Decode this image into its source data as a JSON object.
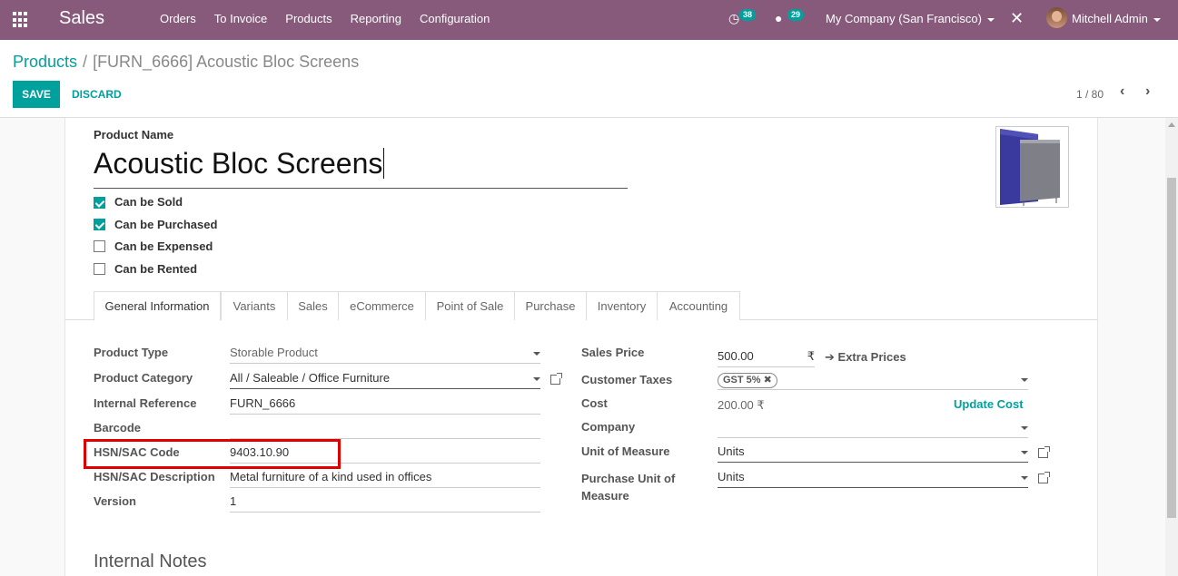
{
  "navbar": {
    "brand": "Sales",
    "menu": [
      "Orders",
      "To Invoice",
      "Products",
      "Reporting",
      "Configuration"
    ],
    "activity_count": "38",
    "message_count": "29",
    "company": "My Company (San Francisco)",
    "user": "Mitchell Admin",
    "icons": [
      "apps-icon",
      "clock-icon",
      "chat-icon",
      "bug-icon"
    ]
  },
  "breadcrumb": {
    "parent": "Products",
    "separator": "/",
    "current": "[FURN_6666] Acoustic Bloc Screens"
  },
  "actions": {
    "save": "SAVE",
    "discard": "DISCARD"
  },
  "pager": {
    "value": "1 / 80"
  },
  "product": {
    "name_label": "Product Name",
    "name": "Acoustic Bloc Screens",
    "flags": [
      {
        "label": "Can be Sold",
        "checked": true
      },
      {
        "label": "Can be Purchased",
        "checked": true
      },
      {
        "label": "Can be Expensed",
        "checked": false
      },
      {
        "label": "Can be Rented",
        "checked": false
      }
    ]
  },
  "tabs": [
    "General Information",
    "Variants",
    "Sales",
    "eCommerce",
    "Point of Sale",
    "Purchase",
    "Inventory",
    "Accounting"
  ],
  "left_fields": {
    "product_type": {
      "label": "Product Type",
      "value": "Storable Product"
    },
    "product_category": {
      "label": "Product Category",
      "value": "All / Saleable / Office Furniture"
    },
    "internal_reference": {
      "label": "Internal Reference",
      "value": "FURN_6666"
    },
    "barcode": {
      "label": "Barcode",
      "value": ""
    },
    "hsn_code": {
      "label": "HSN/SAC Code",
      "value": "9403.10.90"
    },
    "hsn_description": {
      "label": "HSN/SAC Description",
      "value": "Metal furniture of a kind used in offices"
    },
    "version": {
      "label": "Version",
      "value": "1"
    }
  },
  "right_fields": {
    "sales_price": {
      "label": "Sales Price",
      "value": "500.00",
      "currency": "₹",
      "extra": "Extra Prices"
    },
    "customer_taxes": {
      "label": "Customer Taxes",
      "tag": "GST 5%"
    },
    "cost": {
      "label": "Cost",
      "value": "200.00 ₹",
      "action": "Update Cost"
    },
    "company": {
      "label": "Company",
      "value": ""
    },
    "uom": {
      "label": "Unit of Measure",
      "value": "Units"
    },
    "purchase_uom": {
      "label_line1": "Purchase Unit of",
      "label_line2": "Measure",
      "value": "Units"
    }
  },
  "notes": {
    "title": "Internal Notes"
  },
  "colors": {
    "navbar": "#875a7b",
    "accent": "#00a09d",
    "highlight": "#e00000"
  }
}
